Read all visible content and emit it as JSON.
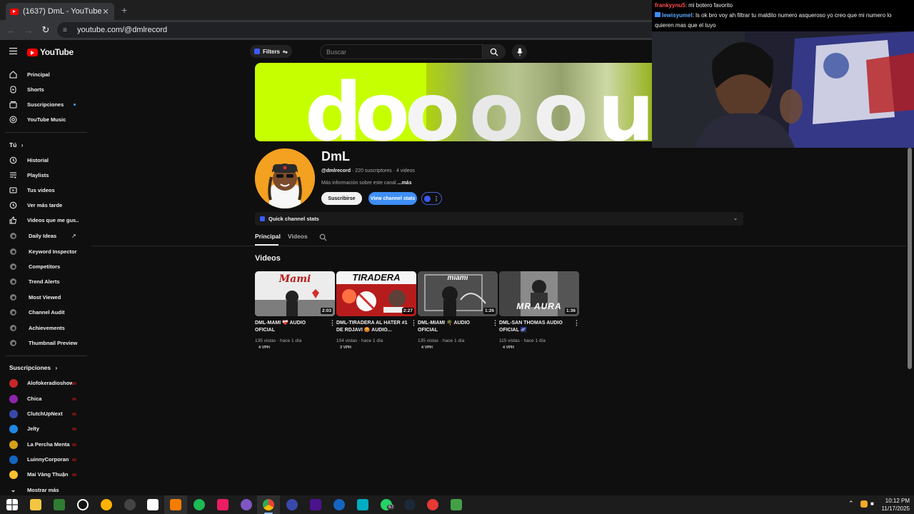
{
  "browser": {
    "tab_title": "(1637) DmL - YouTube",
    "tab_close": "✕",
    "new_tab": "+",
    "url": "youtube.com/@dmlrecord"
  },
  "header": {
    "logo_text": "YouTube",
    "filters_label": "Filters",
    "search_placeholder": "Buscar"
  },
  "sidebar": {
    "main": [
      {
        "label": "Principal",
        "icon": "home-icon"
      },
      {
        "label": "Shorts",
        "icon": "shorts-icon"
      },
      {
        "label": "Suscripciones",
        "icon": "subscriptions-icon"
      },
      {
        "label": "YouTube Music",
        "icon": "music-icon"
      }
    ],
    "you_header": "Tú",
    "you": [
      {
        "label": "Historial",
        "icon": "history-icon"
      },
      {
        "label": "Playlists",
        "icon": "playlists-icon"
      },
      {
        "label": "Tus videos",
        "icon": "your-videos-icon"
      },
      {
        "label": "Ver más tarde",
        "icon": "watch-later-icon"
      },
      {
        "label": "Videos que me gus...",
        "icon": "liked-icon"
      }
    ],
    "extension": [
      "Daily Ideas",
      "Keyword Inspector",
      "Competitors",
      "Trend Alerts",
      "Most Viewed",
      "Channel Audit",
      "Achievements",
      "Thumbnail Preview"
    ],
    "subs_header": "Suscripciones",
    "subscriptions": [
      {
        "label": "Alofokeradioshow",
        "color": "#c62828"
      },
      {
        "label": "Chica",
        "color": "#8e24aa"
      },
      {
        "label": "ClutchUpNext",
        "color": "#3949ab"
      },
      {
        "label": "Jelty",
        "color": "#1e88e5"
      },
      {
        "label": "La Percha Menta",
        "color": "#d4a017"
      },
      {
        "label": "LuinnyCorporan",
        "color": "#1565c0"
      },
      {
        "label": "Mai Vàng Thuận",
        "color": "#fbc02d"
      }
    ],
    "show_more": "Mostrar más"
  },
  "channel": {
    "name": "DmL",
    "handle": "@dmlrecord",
    "stats": " · 220 suscriptores · 4 videos",
    "more_info": "Más información sobre este canal",
    "more_link": " ...más",
    "subscribe": "Suscribirse",
    "view_stats": "View channel stats",
    "quick_stats": "Quick channel stats"
  },
  "tabs": {
    "principal": "Principal",
    "videos": "Videos"
  },
  "section_title": "Videos",
  "videos": [
    {
      "title": "DML-MAMI ❤️‍🩹 AUDIO OFICIAL",
      "duration": "2:03",
      "meta": "135 vistas · hace 1 día",
      "vph": "4 VPH",
      "thumb_text": "Mami",
      "bg": "#e9e9e9"
    },
    {
      "title": "DML-TIRADERA AL HATER #1 DE RDJAVI 😡 AUDIO...",
      "duration": "2:27",
      "meta": "104 vistas · hace 1 día",
      "vph": "3 VPH",
      "thumb_text": "TIRADERA",
      "bg": "#c62828"
    },
    {
      "title": "DML-MIAMI 🌴 AUDIO OFICIAL",
      "duration": "1:26",
      "meta": "135 vistas · hace 1 día",
      "vph": "4 VPH",
      "thumb_text": "miami",
      "bg": "#3a3a3a"
    },
    {
      "title": "DML-SAN THOMAS AUDIO OFICIAL 🌌",
      "duration": "1:36",
      "meta": "115 vistas · hace 1 día",
      "vph": "4 VPH",
      "thumb_text": "MR AURA",
      "bg": "#5a5a5a"
    }
  ],
  "stream": {
    "chat": [
      {
        "user": "frankyynu5",
        "text": ": mi botero favorito"
      },
      {
        "user": "lewisyumel",
        "text": ": ls ok bro voy ah filtrar tu maldito numero asqueroso yo creo que mi numero lo quieren mas que el tuyo"
      }
    ]
  },
  "taskbar": {
    "time": "10:12 PM",
    "date": "11/17/2025",
    "badge": "67"
  }
}
